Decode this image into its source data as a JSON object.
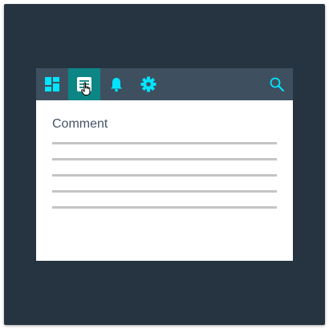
{
  "toolbar": {
    "buttons": [
      {
        "icon": "dashboard-icon",
        "active": false
      },
      {
        "icon": "comment-doc-icon",
        "active": true
      },
      {
        "icon": "bell-icon",
        "active": false
      },
      {
        "icon": "gear-icon",
        "active": false
      }
    ],
    "search_icon": "search-icon"
  },
  "comment": {
    "label": "Comment",
    "line_count": 5
  },
  "colors": {
    "background": "#263441",
    "toolbar": "#3e5060",
    "active_tab": "#0c8585",
    "icon": "#00e5ff",
    "label": "#445566",
    "rule": "#c4c4c4"
  }
}
